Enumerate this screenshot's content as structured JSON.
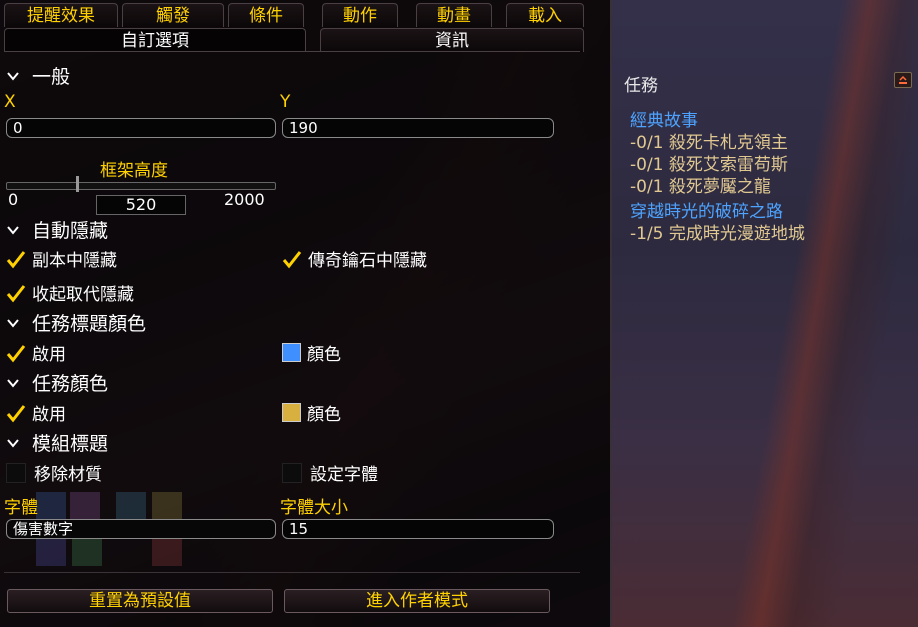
{
  "tabs_row1": [
    "提醒效果",
    "觸發",
    "條件",
    "動作",
    "動畫",
    "載入"
  ],
  "tabs_row2": [
    "自訂選項",
    "資訊"
  ],
  "section_general": "一般",
  "x_label": "X",
  "y_label": "Y",
  "x_value": "0",
  "y_value": "190",
  "frame_height": {
    "label": "框架高度",
    "min": "0",
    "value": "520",
    "max": "2000",
    "fraction": 0.26
  },
  "section_autohide": "自動隱藏",
  "hide_in_instance": "副本中隱藏",
  "hide_in_keystone": "傳奇鑰石中隱藏",
  "hide_collapsed": "收起取代隱藏",
  "section_quest_title_color": "任務標題顏色",
  "enable1": "啟用",
  "color1": "顏色",
  "color1_hex": "#3f8fff",
  "section_quest_color": "任務顏色",
  "enable2": "啟用",
  "color2": "顏色",
  "color2_hex": "#d8b040",
  "section_module_title": "模組標題",
  "remove_texture": "移除材質",
  "set_font": "設定字體",
  "font_label": "字體",
  "font_size_label": "字體大小",
  "font_value": "傷害數字",
  "font_size_value": "15",
  "btn_reset": "重置為預設值",
  "btn_author": "進入作者模式",
  "quest_tracker": {
    "header": "任務",
    "q1_title": "經典故事",
    "q1_obj1": "-0/1 殺死卡札克領主",
    "q1_obj2": "-0/1 殺死艾索雷苟斯",
    "q1_obj3": "-0/1 殺死夢魘之龍",
    "q2_title": "穿越時光的破碎之路",
    "q2_obj1": "-1/5 完成時光漫遊地城"
  }
}
